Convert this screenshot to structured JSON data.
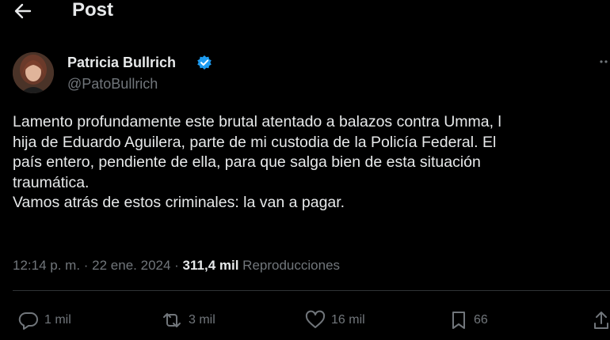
{
  "header": {
    "title": "Post",
    "back_icon": "arrow-left-icon"
  },
  "author": {
    "name": "Patricia Bullrich",
    "handle": "@PatoBullrich",
    "verified_icon": "verified-badge-icon",
    "verified_color": "#1d9bf0"
  },
  "tweet": {
    "lines": [
      "Lamento profundamente este brutal atentado a balazos contra Umma, l",
      "hija de Eduardo Aguilera, parte de mi custodia de la Policía Federal. El",
      "país entero, pendiente de ella, para que salga bien de esta situación",
      "traumática.",
      "Vamos atrás de estos criminales: la van a pagar."
    ]
  },
  "meta": {
    "time": "12:14 p. m.",
    "separator": " · ",
    "date": "22 ene. 2024",
    "views": "311,4 mil",
    "views_label": "Reproducciones"
  },
  "actions": {
    "replies": "1 mil",
    "reposts": "3 mil",
    "likes": "16 mil",
    "bookmarks": "66"
  },
  "colors": {
    "background": "#000000",
    "text": "#e7e9ea",
    "muted": "#71767b"
  }
}
